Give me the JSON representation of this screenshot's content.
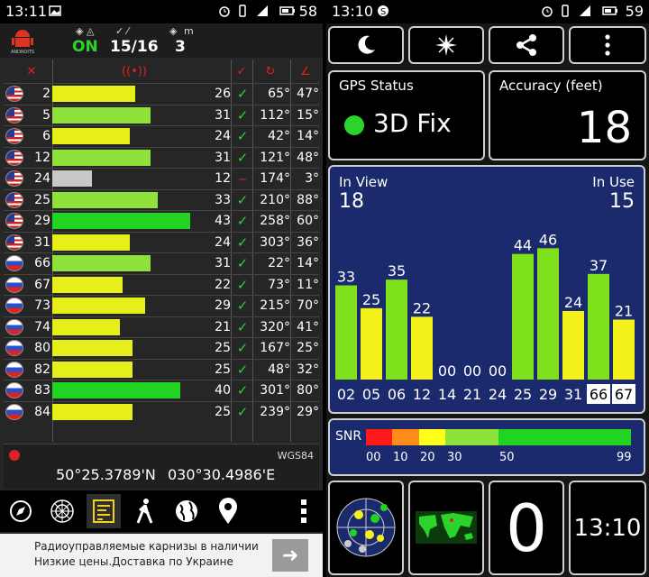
{
  "left": {
    "status": {
      "time": "13:11",
      "battery": "58"
    },
    "header": {
      "fix_state": "ON",
      "sats_used_in_view": "15/16",
      "altitude_m_label": "m",
      "altitude_value": "3"
    },
    "satellites": [
      {
        "prn": "2",
        "flag": "us",
        "snr": "26",
        "used": true,
        "az": "65°",
        "el": "47°",
        "bar_color": "#e6ef1a",
        "bar_level": 0.59
      },
      {
        "prn": "5",
        "flag": "us",
        "snr": "31",
        "used": true,
        "az": "112°",
        "el": "15°",
        "bar_color": "#8fe23a",
        "bar_level": 0.7
      },
      {
        "prn": "6",
        "flag": "us",
        "snr": "24",
        "used": true,
        "az": "42°",
        "el": "14°",
        "bar_color": "#e6ef1a",
        "bar_level": 0.55
      },
      {
        "prn": "12",
        "flag": "us",
        "snr": "31",
        "used": true,
        "az": "121°",
        "el": "48°",
        "bar_color": "#8fe23a",
        "bar_level": 0.7
      },
      {
        "prn": "24",
        "flag": "us",
        "snr": "12",
        "used": false,
        "az": "174°",
        "el": "3°",
        "bar_color": "#c8c8c8",
        "bar_level": 0.28
      },
      {
        "prn": "25",
        "flag": "us",
        "snr": "33",
        "used": true,
        "az": "210°",
        "el": "88°",
        "bar_color": "#8fe23a",
        "bar_level": 0.75
      },
      {
        "prn": "29",
        "flag": "us",
        "snr": "43",
        "used": true,
        "az": "258°",
        "el": "60°",
        "bar_color": "#22d422",
        "bar_level": 0.98
      },
      {
        "prn": "31",
        "flag": "us",
        "snr": "24",
        "used": true,
        "az": "303°",
        "el": "36°",
        "bar_color": "#e6ef1a",
        "bar_level": 0.55
      },
      {
        "prn": "66",
        "flag": "ru",
        "snr": "31",
        "used": true,
        "az": "22°",
        "el": "14°",
        "bar_color": "#8fe23a",
        "bar_level": 0.7
      },
      {
        "prn": "67",
        "flag": "ru",
        "snr": "22",
        "used": true,
        "az": "73°",
        "el": "11°",
        "bar_color": "#e6ef1a",
        "bar_level": 0.5
      },
      {
        "prn": "73",
        "flag": "ru",
        "snr": "29",
        "used": true,
        "az": "215°",
        "el": "70°",
        "bar_color": "#e6ef1a",
        "bar_level": 0.66
      },
      {
        "prn": "74",
        "flag": "ru",
        "snr": "21",
        "used": true,
        "az": "320°",
        "el": "41°",
        "bar_color": "#e6ef1a",
        "bar_level": 0.48
      },
      {
        "prn": "80",
        "flag": "ru",
        "snr": "25",
        "used": true,
        "az": "167°",
        "el": "25°",
        "bar_color": "#e6ef1a",
        "bar_level": 0.57
      },
      {
        "prn": "82",
        "flag": "ru",
        "snr": "25",
        "used": true,
        "az": "48°",
        "el": "32°",
        "bar_color": "#e6ef1a",
        "bar_level": 0.57
      },
      {
        "prn": "83",
        "flag": "ru",
        "snr": "40",
        "used": true,
        "az": "301°",
        "el": "80°",
        "bar_color": "#22d422",
        "bar_level": 0.91
      },
      {
        "prn": "84",
        "flag": "ru",
        "snr": "25",
        "used": true,
        "az": "239°",
        "el": "29°",
        "bar_color": "#e6ef1a",
        "bar_level": 0.57
      }
    ],
    "coords": {
      "datum": "WGS84",
      "lat": "50°25.3789'N",
      "lon": "030°30.4986'E"
    },
    "ad": {
      "line1": "Радиоуправляемые карнизы в наличии",
      "line2": "Низкие цены.Доставка по Украине",
      "arrow": "➜"
    }
  },
  "right": {
    "status": {
      "time": "13:10",
      "battery": "59"
    },
    "gps_status": {
      "label": "GPS Status",
      "value": "3D Fix"
    },
    "accuracy": {
      "label": "Accuracy (feet)",
      "value": "18"
    },
    "in_view": {
      "label": "In View",
      "value": "18"
    },
    "in_use": {
      "label": "In Use",
      "value": "15"
    },
    "snr_legend": {
      "label": "SNR",
      "ticks": [
        "00",
        "10",
        "20",
        "30",
        "50",
        "99"
      ]
    },
    "bottom": {
      "big_digit": "0",
      "clock": "13:10"
    }
  },
  "chart_data": {
    "type": "bar",
    "categories": [
      "02",
      "05",
      "06",
      "12",
      "14",
      "21",
      "24",
      "25",
      "29",
      "31",
      "66",
      "67"
    ],
    "values": [
      33,
      25,
      35,
      22,
      0,
      0,
      0,
      44,
      46,
      24,
      37,
      21
    ],
    "value_labels": [
      "33",
      "25",
      "35",
      "22",
      "00",
      "00",
      "00",
      "44",
      "46",
      "24",
      "37",
      "21"
    ],
    "bar_colors": [
      "#7fe01c",
      "#f2f21a",
      "#7fe01c",
      "#f2f21a",
      "#7fe01c",
      "#7fe01c",
      "#7fe01c",
      "#7fe01c",
      "#7fe01c",
      "#f2f21a",
      "#7fe01c",
      "#f2f21a"
    ],
    "highlighted_categories": [
      "66",
      "67"
    ],
    "ylim": [
      0,
      60
    ],
    "xlabel": "",
    "ylabel": ""
  },
  "colors": {
    "ok_green": "#2bd42b",
    "alert_red": "#e02020",
    "sky_bg": "#1a2a6c"
  }
}
